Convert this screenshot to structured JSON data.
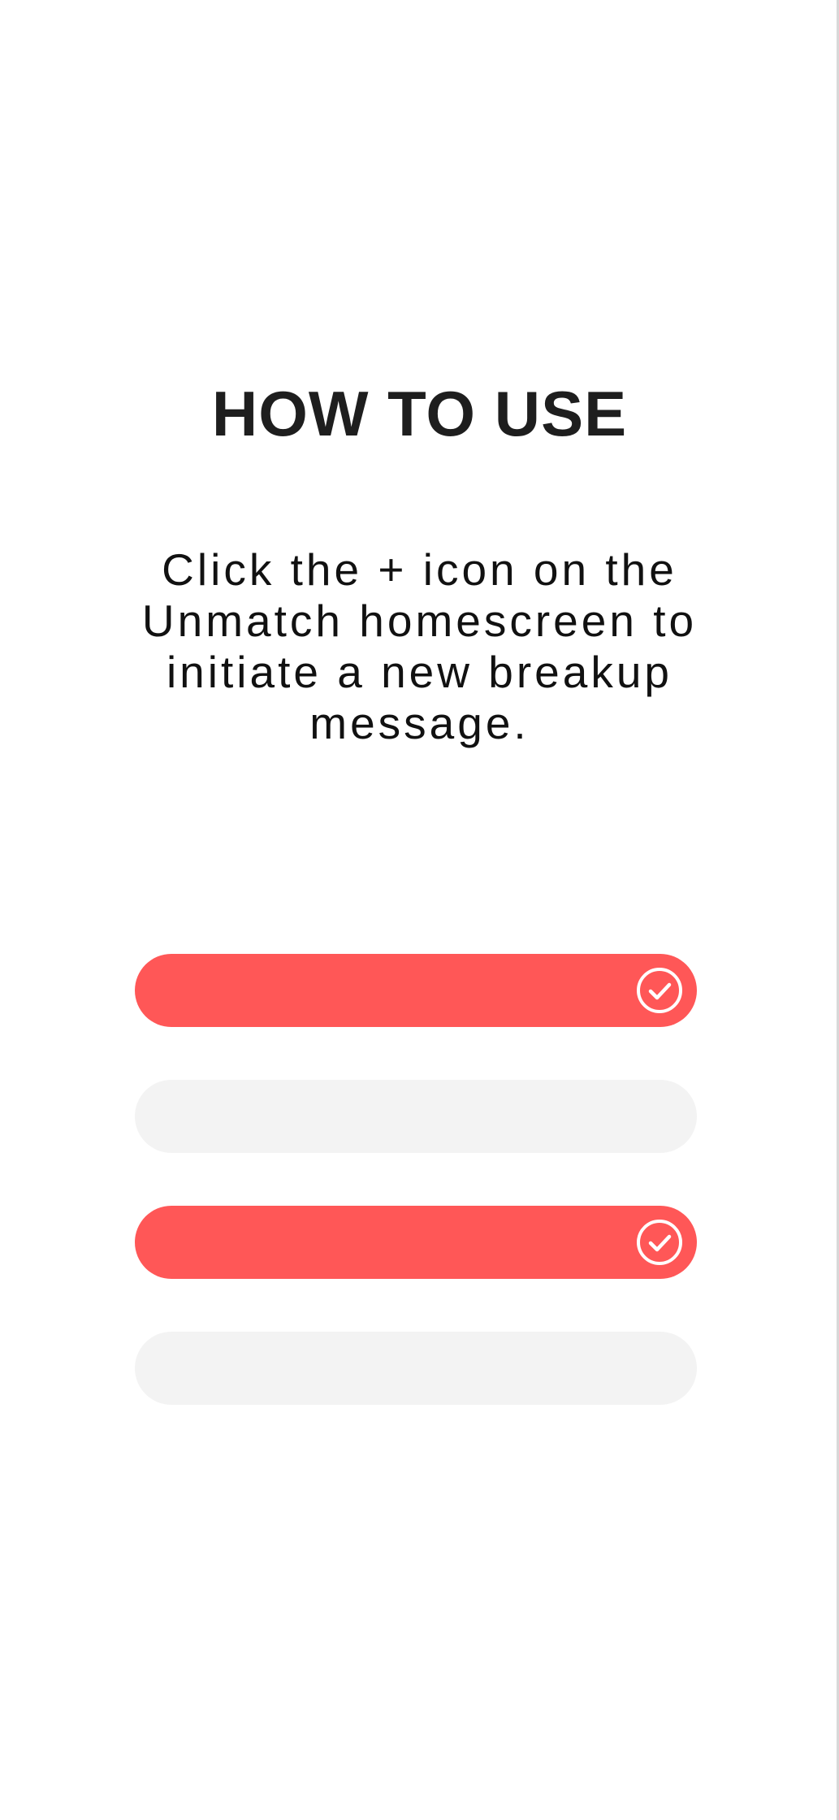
{
  "screen": {
    "title": "HOW TO USE",
    "instruction": "Click the + icon on the Unmatch homescreen to initiate a new breakup message."
  },
  "options": [
    {
      "selected": true,
      "icon": "check-circle-icon"
    },
    {
      "selected": false,
      "icon": "check-circle-icon"
    },
    {
      "selected": true,
      "icon": "check-circle-icon"
    },
    {
      "selected": false,
      "icon": "check-circle-icon"
    }
  ],
  "colors": {
    "accent": "#ff5757",
    "inactive": "#f3f3f3",
    "text": "#1e1e1e",
    "background": "#ffffff"
  }
}
